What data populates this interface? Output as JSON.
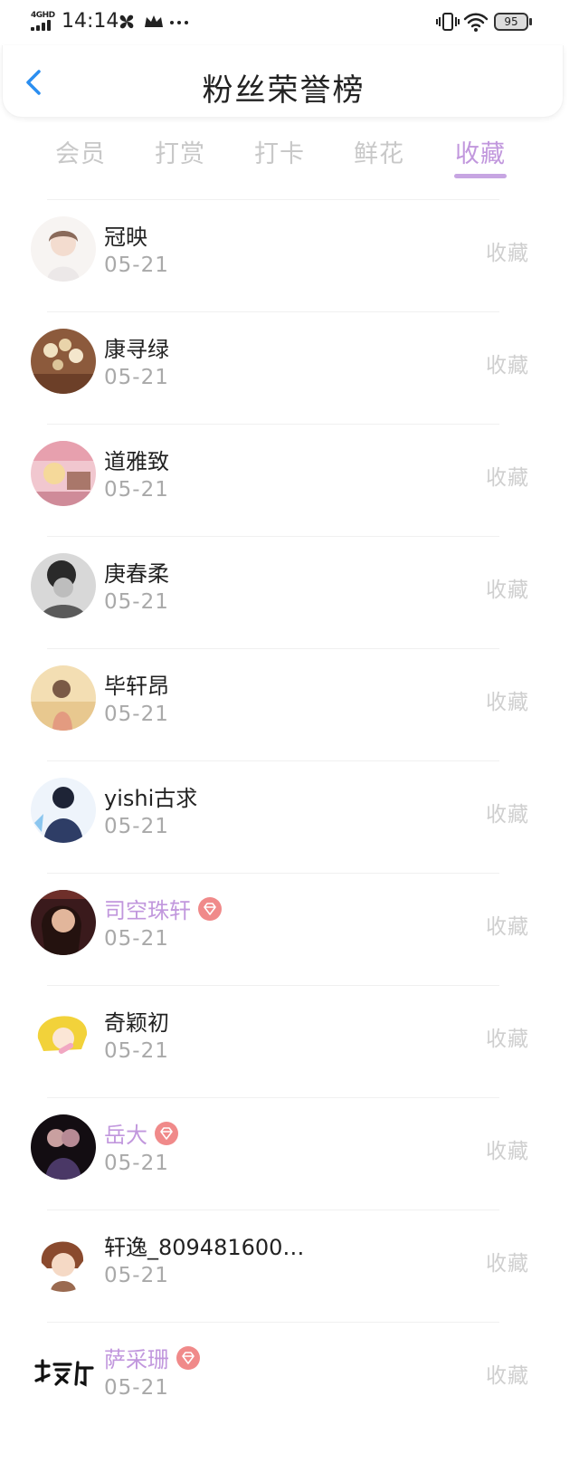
{
  "status_bar": {
    "network": "4GHD",
    "time": "14:14",
    "battery": "95",
    "icons": [
      "pinwheel-icon",
      "crown-icon",
      "more-icon",
      "vibrate-icon",
      "wifi-icon",
      "battery-icon"
    ]
  },
  "header": {
    "title": "粉丝荣誉榜",
    "back_icon": "chevron-left-icon",
    "accent_color": "#2b8ef0"
  },
  "tabs": [
    {
      "label": "会员",
      "active": false
    },
    {
      "label": "打赏",
      "active": false
    },
    {
      "label": "打卡",
      "active": false
    },
    {
      "label": "鲜花",
      "active": false
    },
    {
      "label": "收藏",
      "active": true
    }
  ],
  "colors": {
    "active_tab": "#c197dd",
    "vip_name": "#c197dd",
    "vip_badge": "#f08a8a",
    "date": "#a9a9a9",
    "action": "#cfcfcf"
  },
  "fans": [
    {
      "name": "冠映",
      "date": "05-21",
      "action": "收藏",
      "vip": false
    },
    {
      "name": "康寻绿",
      "date": "05-21",
      "action": "收藏",
      "vip": false
    },
    {
      "name": "道雅致",
      "date": "05-21",
      "action": "收藏",
      "vip": false
    },
    {
      "name": "庚春柔",
      "date": "05-21",
      "action": "收藏",
      "vip": false
    },
    {
      "name": "毕轩昂",
      "date": "05-21",
      "action": "收藏",
      "vip": false
    },
    {
      "name": "yishi古求",
      "date": "05-21",
      "action": "收藏",
      "vip": false
    },
    {
      "name": "司空珠轩",
      "date": "05-21",
      "action": "收藏",
      "vip": true
    },
    {
      "name": "奇颖初",
      "date": "05-21",
      "action": "收藏",
      "vip": false
    },
    {
      "name": "岳大",
      "date": "05-21",
      "action": "收藏",
      "vip": true
    },
    {
      "name": "轩逸_809481600…",
      "date": "05-21",
      "action": "收藏",
      "vip": false
    },
    {
      "name": "萨采珊",
      "date": "05-21",
      "action": "收藏",
      "vip": true
    }
  ]
}
